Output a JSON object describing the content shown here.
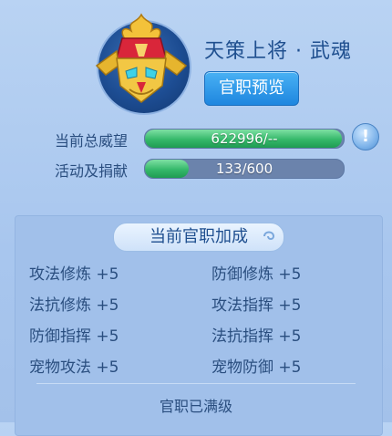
{
  "header": {
    "title": "天策上将 · 武魂",
    "rank_preview_button": "官职预览"
  },
  "stats": {
    "prestige": {
      "label": "当前总威望",
      "value_text": "622996/--",
      "fill": 0.99
    },
    "activity": {
      "label": "活动及捐献",
      "value_text": "133/600",
      "fill": 0.2217
    }
  },
  "bonus_section": {
    "title": "当前官职加成",
    "items": [
      "攻法修炼 +5",
      "防御修炼 +5",
      "法抗修炼 +5",
      "攻法指挥 +5",
      "防御指挥 +5",
      "法抗指挥 +5",
      "宠物攻法 +5",
      "宠物防御 +5"
    ],
    "status": "官职已满级"
  },
  "icons": {
    "emblem": "warrior-helmet-icon",
    "info": "exclamation-icon"
  },
  "colors": {
    "accent_blue": "#1e86df",
    "bar_green": "#35b86a",
    "text": "#2a4e7f"
  }
}
